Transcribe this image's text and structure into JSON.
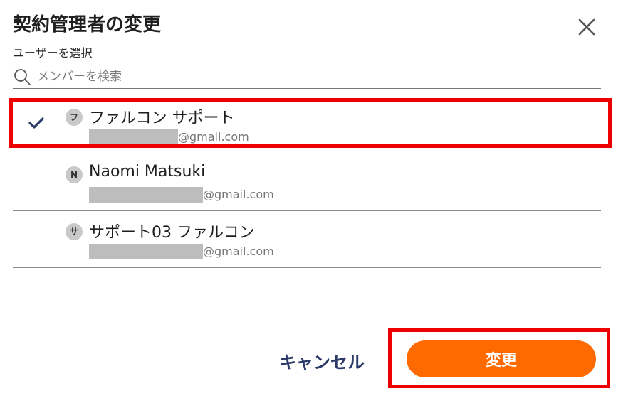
{
  "dialog": {
    "title": "契約管理者の変更",
    "select_label": "ユーザーを選択"
  },
  "search": {
    "placeholder": "メンバーを検索",
    "value": ""
  },
  "users": [
    {
      "avatar": "フ",
      "name": "ファルコン サポート",
      "email_domain": "@gmail.com",
      "selected": true
    },
    {
      "avatar": "N",
      "name": "Naomi Matsuki",
      "email_domain": "@gmail.com",
      "selected": false
    },
    {
      "avatar": "サ",
      "name": "サポート03 ファルコン",
      "email_domain": "@gmail.com",
      "selected": false
    }
  ],
  "actions": {
    "cancel_label": "キャンセル",
    "change_label": "変更"
  },
  "colors": {
    "primary": "#ff6a00",
    "cancel_text": "#2b3a67",
    "check": "#2b3a67",
    "highlight": "#ee0000"
  },
  "icons": {
    "close": "close-icon",
    "search": "search-icon",
    "check": "check-icon"
  }
}
